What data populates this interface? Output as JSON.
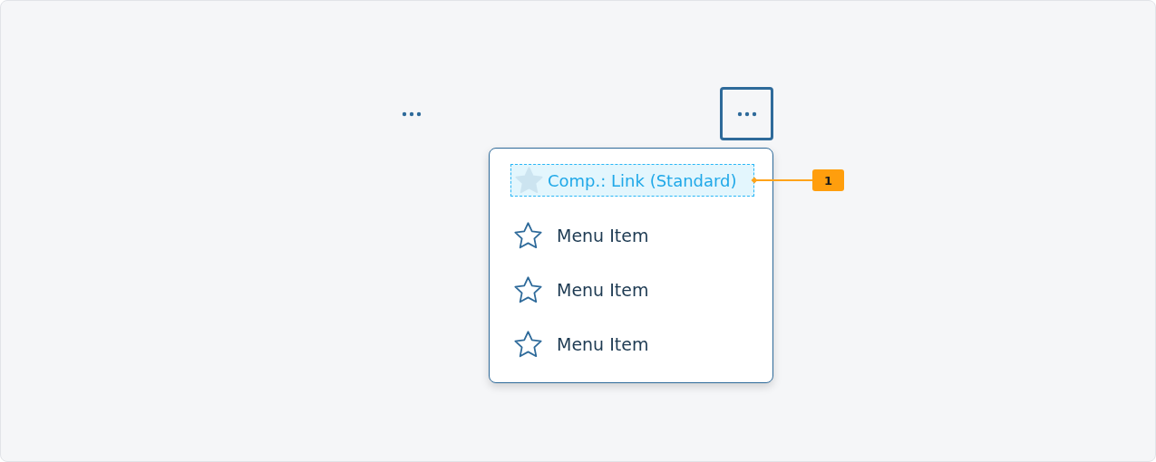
{
  "menu_button": {
    "expanded": true
  },
  "menu_items": [
    {
      "kind": "annotated",
      "label": "Comp.: Link (Standard)",
      "annotation": "1"
    },
    {
      "kind": "item",
      "label": "Menu Item"
    },
    {
      "kind": "item",
      "label": "Menu Item"
    },
    {
      "kind": "item",
      "label": "Menu Item"
    }
  ]
}
